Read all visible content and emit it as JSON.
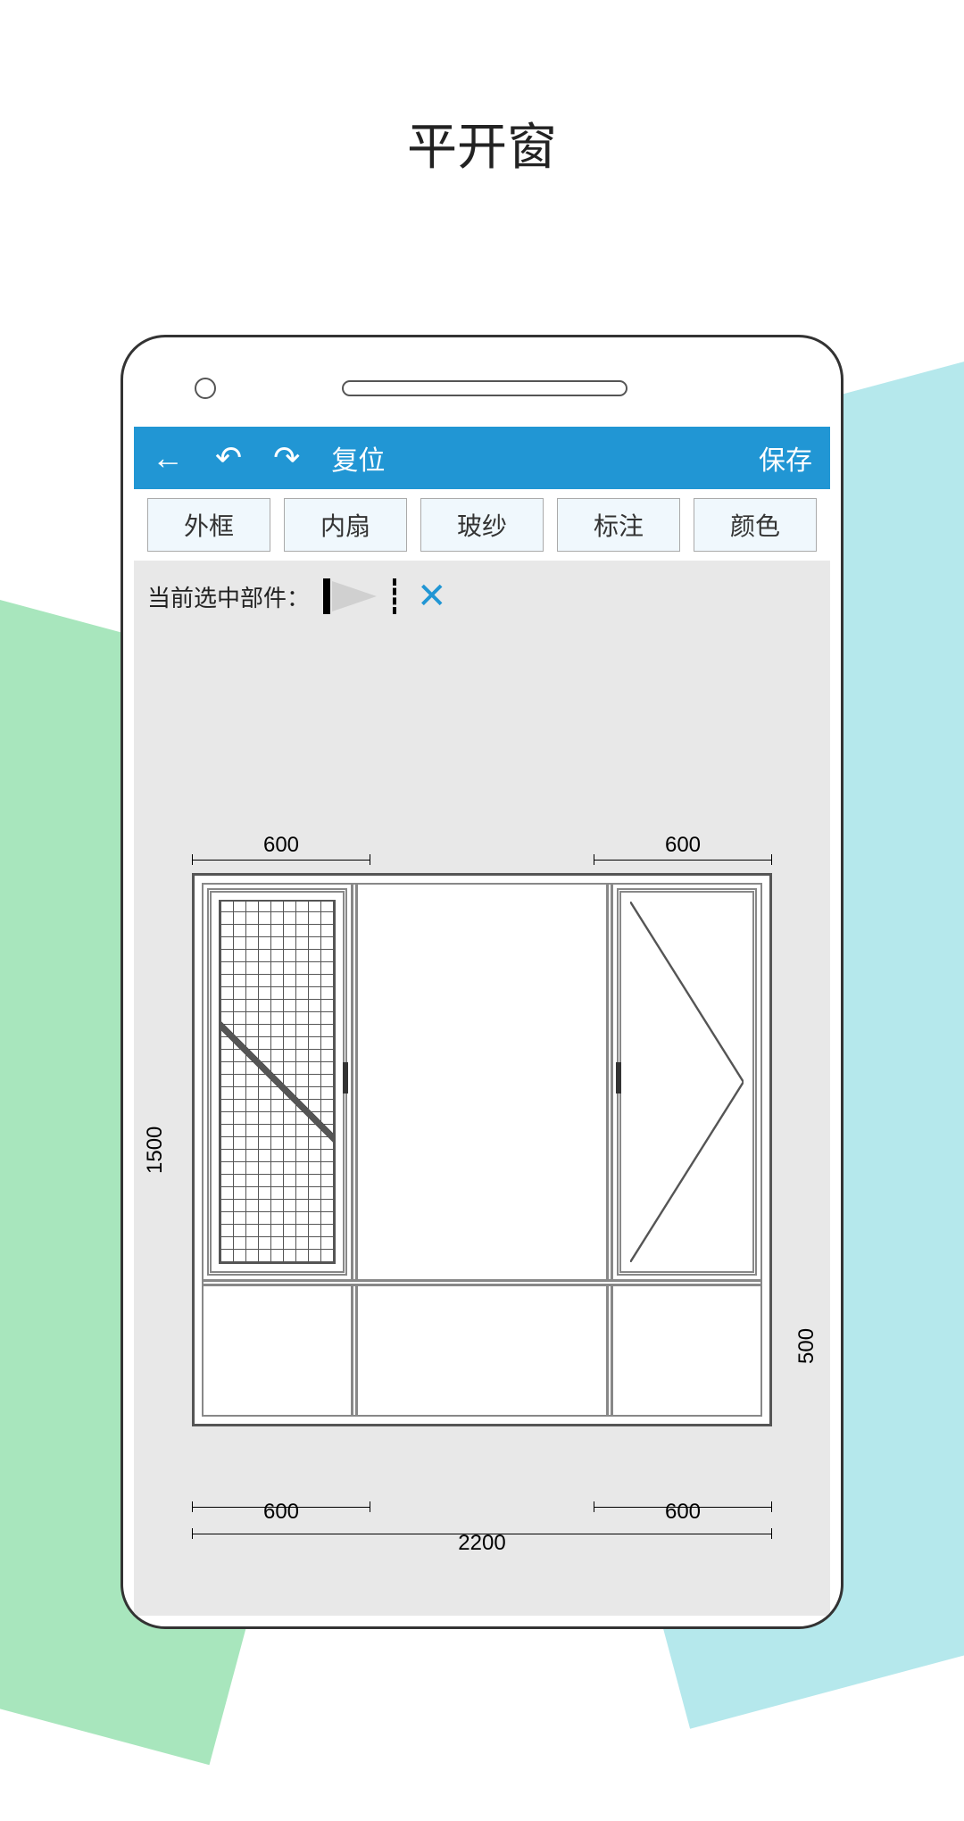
{
  "page": {
    "title": "平开窗"
  },
  "toolbar": {
    "reset_label": "复位",
    "save_label": "保存"
  },
  "tabs": {
    "outer_frame": "外框",
    "inner_sash": "内扇",
    "glass_screen": "玻纱",
    "annotation": "标注",
    "color": "颜色"
  },
  "selected": {
    "label": "当前选中部件："
  },
  "dimensions": {
    "top_left": "600",
    "top_right": "600",
    "left_height": "1500",
    "right_height": "500",
    "bottom_left": "600",
    "bottom_right": "600",
    "total_width": "2200"
  }
}
